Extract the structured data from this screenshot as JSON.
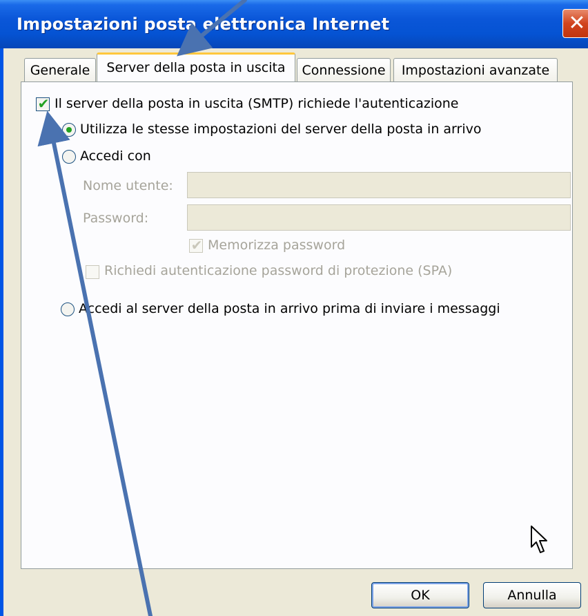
{
  "window": {
    "title": "Impostazioni posta elettronica Internet",
    "close_label": "✕"
  },
  "tabs": [
    {
      "label": "Generale",
      "active": false
    },
    {
      "label": "Server della posta in uscita",
      "active": true
    },
    {
      "label": "Connessione",
      "active": false
    },
    {
      "label": "Impostazioni avanzate",
      "active": false
    }
  ],
  "outgoing": {
    "smtp_auth_label": "Il server della posta in uscita (SMTP) richiede l'autenticazione",
    "smtp_auth_checked": true,
    "use_same_label": "Utilizza le stesse impostazioni del server della posta in arrivo",
    "use_same_selected": true,
    "login_with_label": "Accedi con",
    "username_label": "Nome utente:",
    "username_value": "",
    "password_label": "Password:",
    "password_value": "",
    "remember_password_label": "Memorizza password",
    "remember_password_checked": true,
    "spa_label": "Richiedi autenticazione password di protezione (SPA)",
    "spa_checked": false,
    "login_incoming_first_label": "Accedi al server della posta in arrivo prima di inviare i messaggi"
  },
  "buttons": {
    "ok_label": "OK",
    "cancel_label": "Annulla"
  },
  "colors": {
    "titlebar": "#0553d3",
    "dialog_bg": "#ece9d8",
    "annotation_arrow": "#4a72b0",
    "check_green": "#21a121"
  }
}
